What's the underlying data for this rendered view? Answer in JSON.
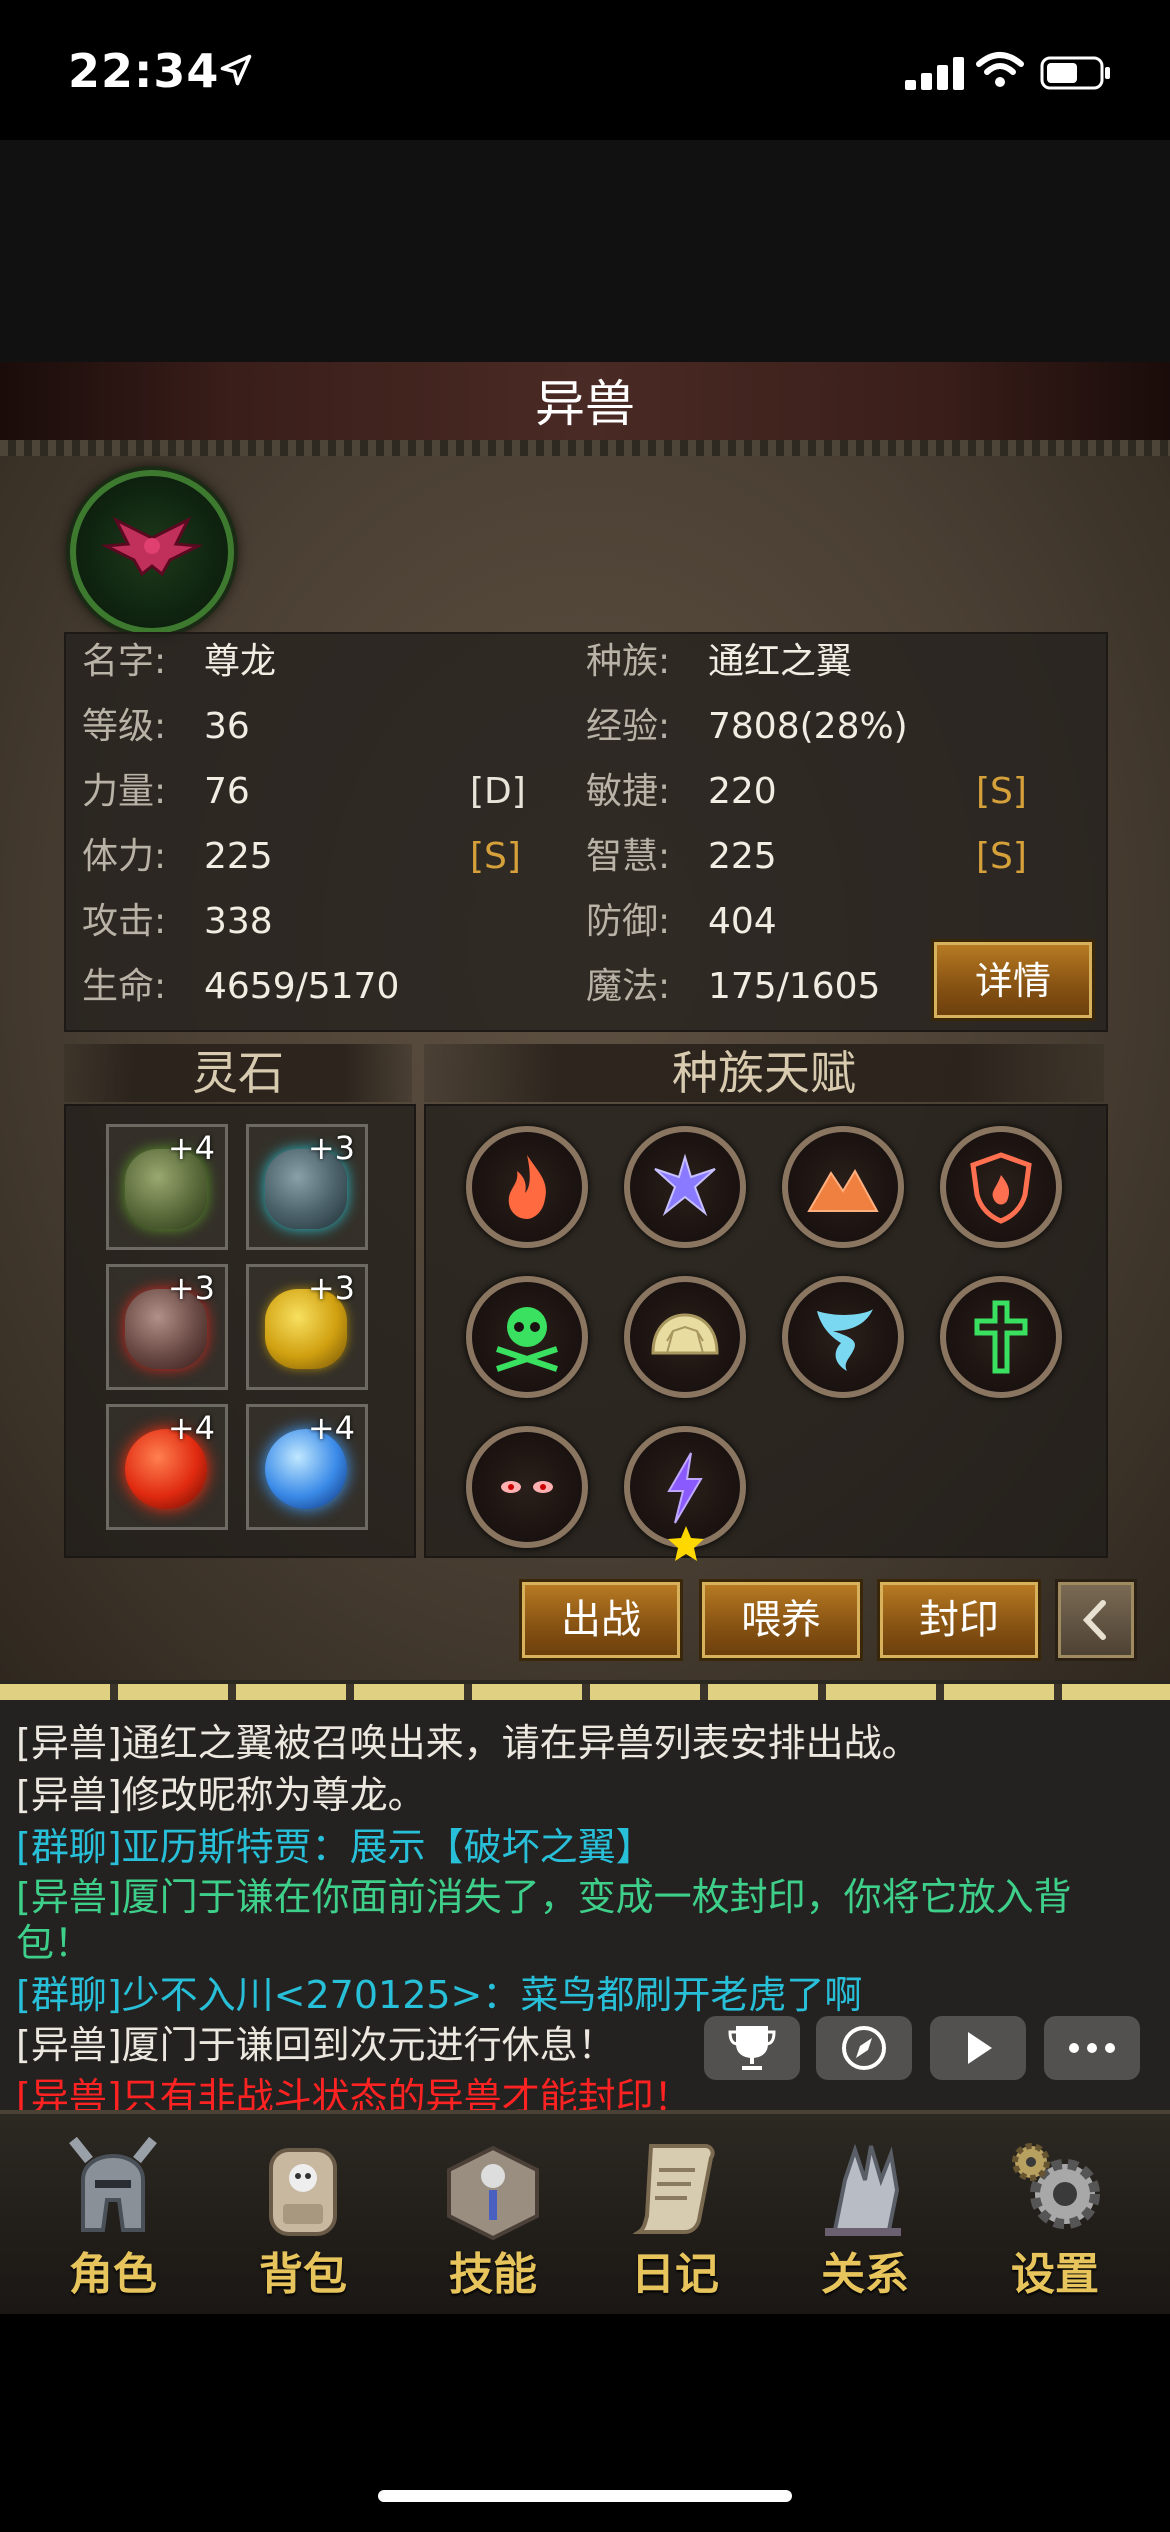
{
  "status_bar": {
    "time": "22:34"
  },
  "title": "异兽",
  "stats": {
    "rows": [
      {
        "left_label": "名字:",
        "left_value": "尊龙",
        "left_grade": "",
        "right_label": "种族:",
        "right_value": "通红之翼",
        "right_grade": ""
      },
      {
        "left_label": "等级:",
        "left_value": "36",
        "left_grade": "",
        "right_label": "经验:",
        "right_value": "7808(28%)",
        "right_grade": ""
      },
      {
        "left_label": "力量:",
        "left_value": "76",
        "left_grade": "[D]",
        "right_label": "敏捷:",
        "right_value": "220",
        "right_grade": "[S]"
      },
      {
        "left_label": "体力:",
        "left_value": "225",
        "left_grade": "[S]",
        "right_label": "智慧:",
        "right_value": "225",
        "right_grade": "[S]"
      },
      {
        "left_label": "攻击:",
        "left_value": "338",
        "left_grade": "",
        "right_label": "防御:",
        "right_value": "404",
        "right_grade": ""
      },
      {
        "left_label": "生命:",
        "left_value": "4659/5170",
        "left_grade": "",
        "right_label": "魔法:",
        "right_value": "175/1605",
        "right_grade": ""
      }
    ],
    "detail_button": "详情"
  },
  "spirit_stones": {
    "header": "灵石",
    "slots": [
      {
        "icon": "green-rune-stone-icon",
        "level": "+4",
        "color": "#5a8a2a"
      },
      {
        "icon": "teal-rune-stone-icon",
        "level": "+3",
        "color": "#2a8a9a"
      },
      {
        "icon": "red-rune-stone-icon",
        "level": "+3",
        "color": "#b03020"
      },
      {
        "icon": "yellow-rune-stone-icon",
        "level": "+3",
        "color": "#d8b020"
      },
      {
        "icon": "red-orb-icon",
        "level": "+4",
        "color": "#e03010"
      },
      {
        "icon": "blue-orb-icon",
        "level": "+4",
        "color": "#3080e0"
      }
    ]
  },
  "race_talents": {
    "header": "种族天赋",
    "icons": [
      "fire-icon",
      "winged-figure-icon",
      "mountains-icon",
      "fire-shield-icon",
      "skull-crossbones-icon",
      "shell-icon",
      "tornado-icon",
      "cross-icon",
      "red-eyes-icon",
      "lightning-star-icon"
    ]
  },
  "actions": {
    "deploy": "出战",
    "feed": "喂养",
    "seal": "封印"
  },
  "chat": {
    "messages": [
      {
        "text": "[异兽]通红之翼被召唤出来，请在异兽列表安排出战。",
        "color": "white"
      },
      {
        "text": "[异兽]修改昵称为尊龙。",
        "color": "white"
      },
      {
        "text": "[群聊]亚历斯特贾：展示【破坏之翼】",
        "color": "cyan"
      },
      {
        "text": "[异兽]厦门于谦在你面前消失了，变成一枚封印，你将它放入背包！",
        "color": "green"
      },
      {
        "text": "[群聊]少不入川<270125>：菜鸟都刷开老虎了啊",
        "color": "cyan"
      },
      {
        "text": "[异兽]厦门于谦回到次元进行休息！",
        "color": "white"
      },
      {
        "text": "[异兽]只有非战斗状态的异兽才能封印！",
        "color": "red"
      }
    ]
  },
  "nav": [
    {
      "label": "角色",
      "icon": "helmet-icon"
    },
    {
      "label": "背包",
      "icon": "backpack-icon"
    },
    {
      "label": "技能",
      "icon": "skill-book-icon"
    },
    {
      "label": "日记",
      "icon": "scroll-icon"
    },
    {
      "label": "关系",
      "icon": "gauntlet-icon"
    },
    {
      "label": "设置",
      "icon": "gears-icon"
    }
  ]
}
